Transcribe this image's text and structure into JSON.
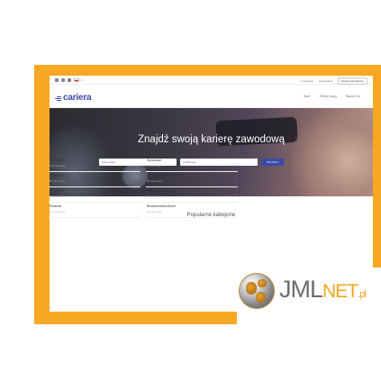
{
  "topbar": {
    "social_icons": [
      "facebook-icon",
      "linkedin-icon",
      "instagram-icon"
    ],
    "language_flag": "pl",
    "login": "Logowanie",
    "register": "Rejestracja",
    "employer_zone": "Strefa pracodawcy"
  },
  "logo": {
    "text": "cariera"
  },
  "nav": {
    "items": [
      "Start",
      "Oferty pracy",
      "Baza CVs"
    ]
  },
  "hero": {
    "title": "Znajdź swoją karierę zawodową",
    "search_placeholder": "Stanowisko",
    "location_placeholder": "Lokalizacja",
    "search_button": "SZUKAJ"
  },
  "categories": {
    "title": "Popularne kategorie",
    "items": [
      {
        "name": "Pozostałe",
        "count": "119 ofert pracy"
      },
      {
        "name": "Sprzedaż",
        "count": "35 ofert pracy"
      },
      {
        "name": "Produkcja",
        "count": "68 ofert pracy"
      },
      {
        "name": "Administracja biurowa",
        "count": "45 ofert pracy"
      },
      {
        "name": "Inżynieria",
        "count": "36 ofert pracy"
      },
      {
        "name": "Obsługa klienta",
        "count": "33 ofert pracy"
      },
      {
        "name": "Finanse",
        "count": "21 ofert pracy"
      },
      {
        "name": "Budownictwo/Archi",
        "count": "24 ofert pracy"
      }
    ]
  },
  "watermark": {
    "brand_a": "JML",
    "brand_b": "NET",
    "brand_c": ".pl"
  },
  "colors": {
    "frame": "#f7a823",
    "accent": "#3b4aa8"
  }
}
